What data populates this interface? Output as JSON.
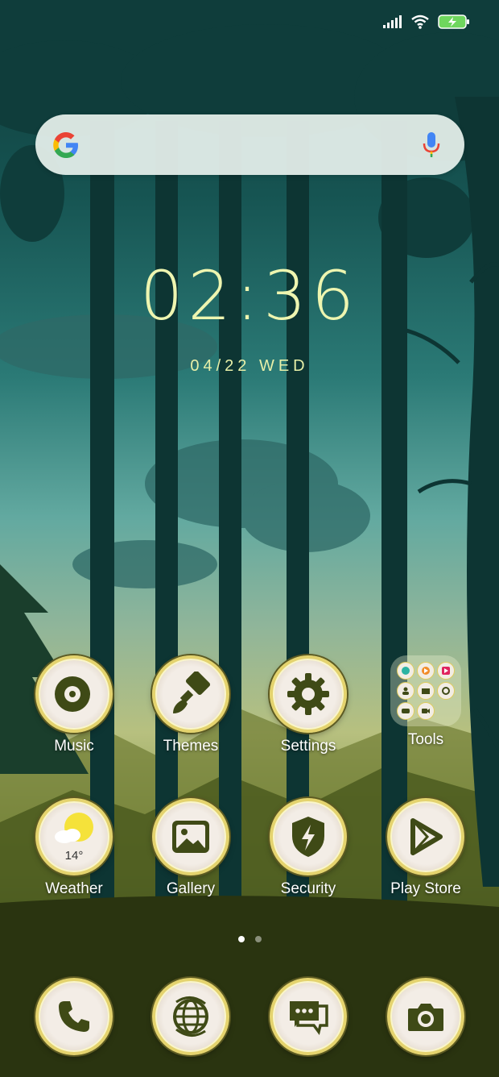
{
  "clock": {
    "time": "02:36",
    "date": "04/22 WED"
  },
  "search": {
    "engine": "Google"
  },
  "apps": [
    {
      "label": "Music",
      "icon": "music-disc-icon"
    },
    {
      "label": "Themes",
      "icon": "paintbrush-icon"
    },
    {
      "label": "Settings",
      "icon": "gear-icon"
    },
    {
      "label": "Tools",
      "icon": "folder-icon"
    },
    {
      "label": "Weather",
      "icon": "weather-sun-cloud-icon",
      "temp": "14°"
    },
    {
      "label": "Gallery",
      "icon": "image-icon"
    },
    {
      "label": "Security",
      "icon": "shield-bolt-icon"
    },
    {
      "label": "Play Store",
      "icon": "play-triangle-icon"
    }
  ],
  "dock": [
    {
      "name": "phone",
      "icon": "phone-icon"
    },
    {
      "name": "browser",
      "icon": "globe-icon"
    },
    {
      "name": "messages",
      "icon": "chat-bubbles-icon"
    },
    {
      "name": "camera",
      "icon": "camera-icon"
    }
  ],
  "pages": {
    "count": 2,
    "active": 1
  },
  "colors": {
    "icon_accent": "#3f4a16",
    "ring": "#e4d36e",
    "clock": "#eef5b0"
  }
}
